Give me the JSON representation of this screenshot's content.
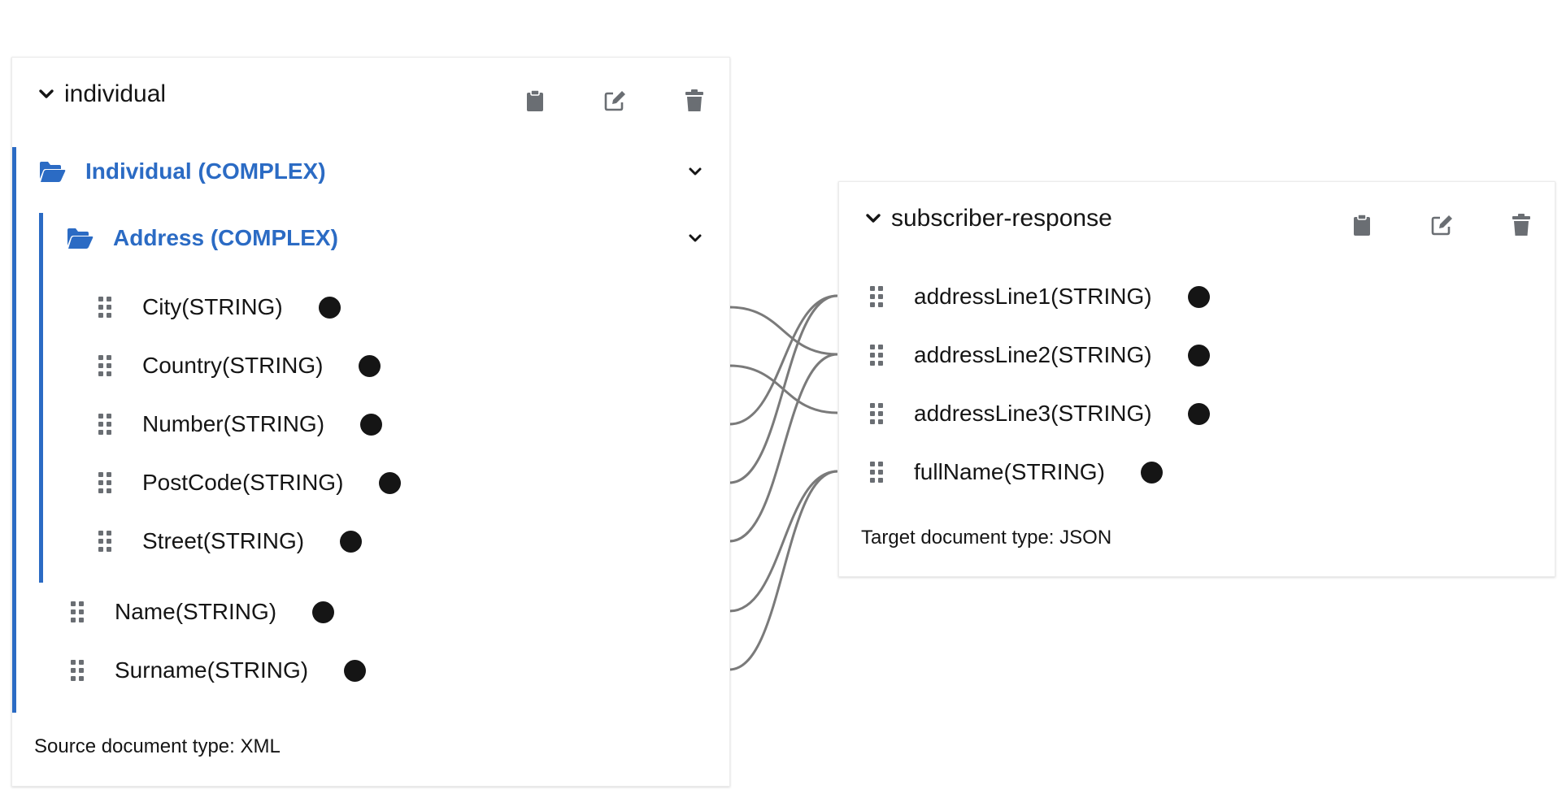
{
  "source": {
    "title": "individual",
    "actions": [
      "clipboard-icon",
      "edit-icon",
      "trash-icon"
    ],
    "group": {
      "label": "Individual (COMPLEX)"
    },
    "subgroup": {
      "label": "Address (COMPLEX)"
    },
    "address_fields": [
      "City(STRING)",
      "Country(STRING)",
      "Number(STRING)",
      "PostCode(STRING)",
      "Street(STRING)"
    ],
    "individual_fields": [
      "Name(STRING)",
      "Surname(STRING)"
    ],
    "doc_type": "Source document type: XML"
  },
  "target": {
    "title": "subscriber-response",
    "actions": [
      "clipboard-icon",
      "edit-icon",
      "trash-icon"
    ],
    "fields": [
      "addressLine1(STRING)",
      "addressLine2(STRING)",
      "addressLine3(STRING)",
      "fullName(STRING)"
    ],
    "doc_type": "Target document type: JSON"
  },
  "mappings": [
    {
      "from": "City(STRING)",
      "to": "addressLine2(STRING)"
    },
    {
      "from": "Country(STRING)",
      "to": "addressLine3(STRING)"
    },
    {
      "from": "Number(STRING)",
      "to": "addressLine1(STRING)"
    },
    {
      "from": "PostCode(STRING)",
      "to": "addressLine1(STRING)"
    },
    {
      "from": "Street(STRING)",
      "to": "addressLine2(STRING)"
    },
    {
      "from": "Name(STRING)",
      "to": "fullName(STRING)"
    },
    {
      "from": "Surname(STRING)",
      "to": "fullName(STRING)"
    }
  ],
  "colors": {
    "accent": "#2b6bc4",
    "text": "#151515",
    "icon": "#6a6e73",
    "link": "#7a7a7a"
  }
}
